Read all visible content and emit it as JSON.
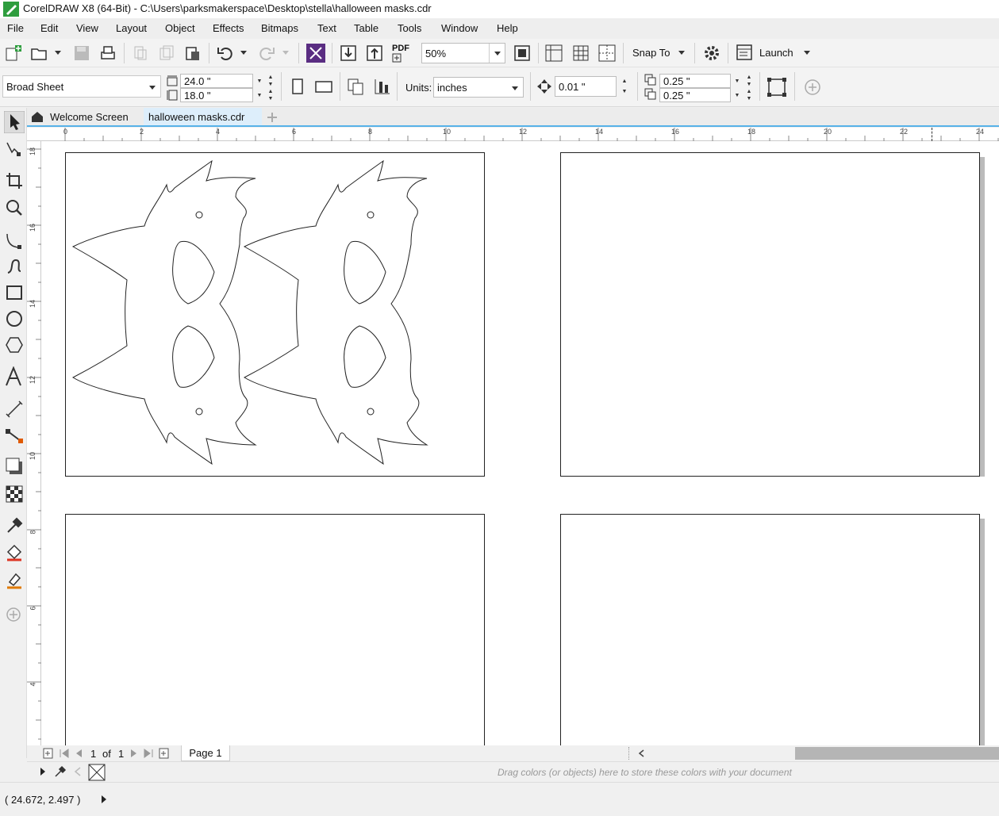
{
  "app": {
    "title": "CorelDRAW X8 (64-Bit) - C:\\Users\\parksmakerspace\\Desktop\\stella\\halloween masks.cdr"
  },
  "menu": [
    "File",
    "Edit",
    "View",
    "Layout",
    "Object",
    "Effects",
    "Bitmaps",
    "Text",
    "Table",
    "Tools",
    "Window",
    "Help"
  ],
  "toolbar": {
    "zoom": "50%",
    "pdf_label": "PDF",
    "snap_label": "Snap To",
    "launch_label": "Launch"
  },
  "propbar": {
    "paper": "Broad Sheet",
    "width": "24.0 \"",
    "height": "18.0 \"",
    "units_label": "Units:",
    "units": "inches",
    "nudge": "0.01 \"",
    "dup_x": "0.25 \"",
    "dup_y": "0.25 \""
  },
  "tabs": [
    {
      "label": "Welcome Screen"
    },
    {
      "label": "halloween masks.cdr"
    }
  ],
  "ruler_top": [
    "0",
    "2",
    "4",
    "6",
    "8",
    "10",
    "12",
    "14",
    "16",
    "18",
    "20",
    "22",
    "24"
  ],
  "ruler_left": [
    "18",
    "16",
    "14",
    "12",
    "10",
    "8",
    "6",
    "4"
  ],
  "pagenav": {
    "current": "1",
    "of_label": "of",
    "total": "1",
    "page_tab": "Page 1"
  },
  "palette_hint": "Drag colors (or objects) here to store these colors with your document",
  "status": {
    "coords": "( 24.672, 2.497  )"
  },
  "icons": [
    "new-document-icon",
    "open-folder-icon",
    "save-icon",
    "print-icon",
    "undo-icon",
    "redo-icon",
    "import-icon",
    "export-icon",
    "zoom-page-icon",
    "gear-icon",
    "pick-tool-icon",
    "shape-tool-icon",
    "crop-tool-icon",
    "zoom-tool-icon",
    "freehand-tool-icon",
    "rectangle-tool-icon",
    "ellipse-tool-icon",
    "polygon-tool-icon",
    "text-tool-icon",
    "eyedropper-icon",
    "home-icon"
  ]
}
